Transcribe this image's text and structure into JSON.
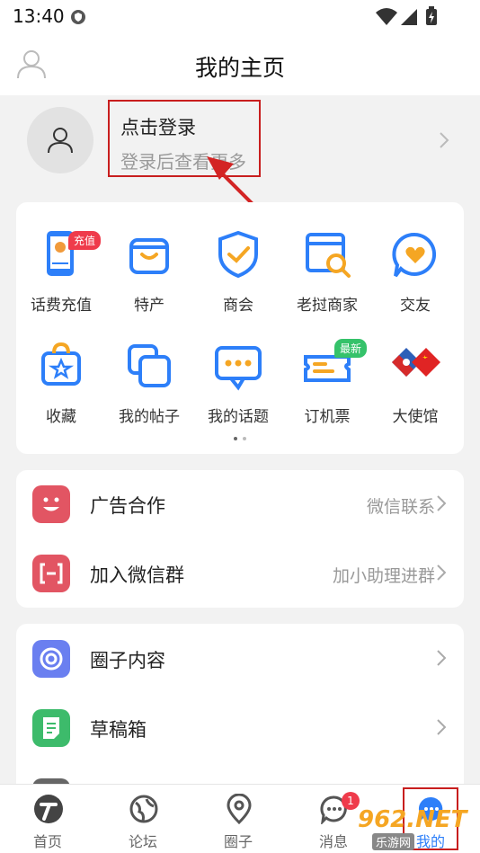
{
  "status_bar": {
    "time": "13:40"
  },
  "header": {
    "title": "我的主页"
  },
  "login": {
    "title": "点击登录",
    "subtitle": "登录后查看更多"
  },
  "grid": {
    "items": [
      {
        "label": "话费充值",
        "badge": "充值"
      },
      {
        "label": "特产"
      },
      {
        "label": "商会"
      },
      {
        "label": "老挝商家"
      },
      {
        "label": "交友"
      },
      {
        "label": "收藏"
      },
      {
        "label": "我的帖子"
      },
      {
        "label": "我的话题"
      },
      {
        "label": "订机票",
        "badge": "最新"
      },
      {
        "label": "大使馆"
      }
    ]
  },
  "menu1": [
    {
      "label": "广告合作",
      "right": "微信联系",
      "icon": "smile-icon",
      "color": "#e25563"
    },
    {
      "label": "加入微信群",
      "right": "加小助理进群",
      "icon": "scan-icon",
      "color": "#e25563"
    }
  ],
  "menu2": [
    {
      "label": "圈子内容",
      "icon": "circle-icon",
      "color": "#6a7ff0"
    },
    {
      "label": "草稿箱",
      "icon": "draft-icon",
      "color": "#3dbb6b"
    }
  ],
  "tabbar": {
    "tabs": [
      {
        "label": "首页",
        "icon": "home-logo-icon"
      },
      {
        "label": "论坛",
        "icon": "globe-icon"
      },
      {
        "label": "圈子",
        "icon": "location-pin-icon"
      },
      {
        "label": "消息",
        "icon": "chat-bubble-icon",
        "badge": "1"
      },
      {
        "label": "我的",
        "icon": "more-bubble-icon"
      }
    ]
  },
  "watermark": {
    "text": "962.NET",
    "sub": "乐游网"
  },
  "colors": {
    "accent": "#2d7ff9",
    "annotation": "#c81e1e",
    "badge": "#ef3b4b"
  }
}
